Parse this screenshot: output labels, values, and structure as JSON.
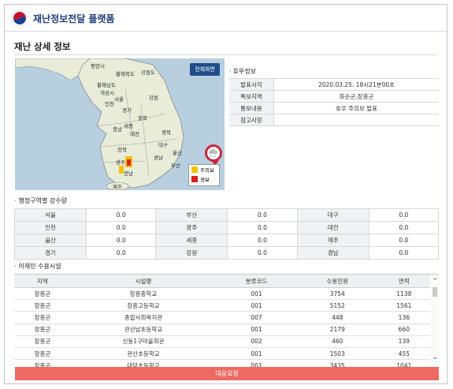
{
  "header": {
    "app_title": "재난정보전달 플랫폼"
  },
  "page": {
    "title": "재난 상세 정보"
  },
  "map": {
    "fullscreen_label": "전체화면",
    "legend": [
      {
        "label": "주의보",
        "color": "#f2c200"
      },
      {
        "label": "경보",
        "color": "#d82020"
      }
    ],
    "region_labels": [
      "평양시",
      "황해북도",
      "강원도",
      "황해남도",
      "개성시",
      "서울",
      "인천",
      "경기",
      "강원",
      "충북",
      "충남",
      "세종",
      "대전",
      "경북",
      "대구",
      "전북",
      "경남",
      "울산",
      "광주",
      "전남",
      "부산",
      "제주"
    ],
    "marker_icon": "rain-cloud-icon"
  },
  "warning_info": {
    "heading": "호우정보",
    "rows": [
      {
        "key": "발표시각",
        "value": "2020.03.25. 18시21분00초"
      },
      {
        "key": "특보지역",
        "value": "화순군,장흥군"
      },
      {
        "key": "통보내용",
        "value": "호우 주의보 발표"
      },
      {
        "key": "참고사항",
        "value": ""
      }
    ]
  },
  "rainfall": {
    "heading": "행정구역별 강수량",
    "rows": [
      [
        {
          "region": "서울",
          "value": "0.0"
        },
        {
          "region": "부산",
          "value": "0.0"
        },
        {
          "region": "대구",
          "value": "0.0"
        }
      ],
      [
        {
          "region": "인천",
          "value": "0.0"
        },
        {
          "region": "광주",
          "value": "0.0"
        },
        {
          "region": "대전",
          "value": "0.0"
        }
      ],
      [
        {
          "region": "울산",
          "value": "0.0"
        },
        {
          "region": "세종",
          "value": "0.0"
        },
        {
          "region": "제주",
          "value": "0.0"
        }
      ],
      [
        {
          "region": "경기",
          "value": "0.0"
        },
        {
          "region": "강원",
          "value": "0.0"
        },
        {
          "region": "경남",
          "value": "0.0"
        }
      ]
    ]
  },
  "facilities": {
    "heading": "이재민 수용시설",
    "columns": [
      "지역",
      "시설명",
      "분류코드",
      "수용인원",
      "면적"
    ],
    "rows": [
      [
        "장흥군",
        "장흥중학교",
        "001",
        "3754",
        "1138"
      ],
      [
        "장흥군",
        "장흥고등학교",
        "001",
        "5152",
        "1561"
      ],
      [
        "장흥군",
        "종합사회복지관",
        "007",
        "448",
        "136"
      ],
      [
        "장흥군",
        "관산남초등학교",
        "001",
        "2179",
        "660"
      ],
      [
        "장흥군",
        "신동1구마을회관",
        "002",
        "460",
        "139"
      ],
      [
        "장흥군",
        "관산초등학교",
        "001",
        "1503",
        "455"
      ],
      [
        "장흥군",
        "대덕초등학교",
        "001",
        "3435",
        "1041"
      ]
    ]
  },
  "action": {
    "label": "대응요령"
  }
}
